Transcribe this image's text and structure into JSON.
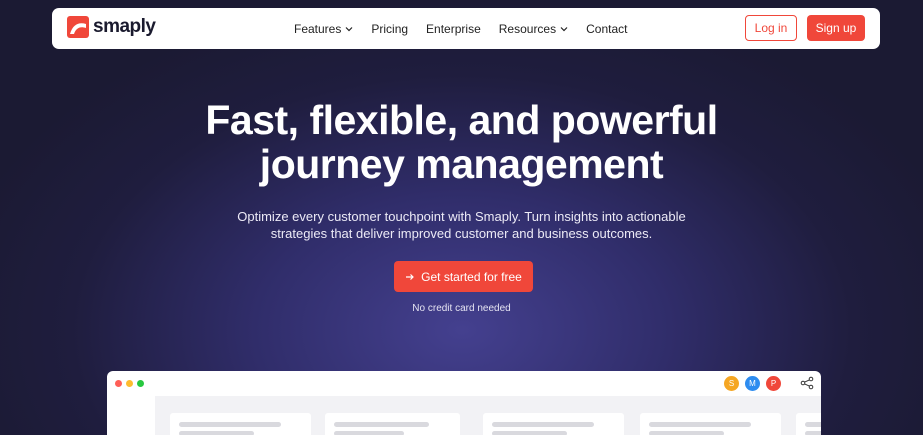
{
  "navbar": {
    "brand": "smaply",
    "links": [
      {
        "label": "Features",
        "has_dropdown": true
      },
      {
        "label": "Pricing",
        "has_dropdown": false
      },
      {
        "label": "Enterprise",
        "has_dropdown": false
      },
      {
        "label": "Resources",
        "has_dropdown": true
      },
      {
        "label": "Contact",
        "has_dropdown": false
      }
    ],
    "login_label": "Log in",
    "signup_label": "Sign up"
  },
  "hero": {
    "title_line1": "Fast, flexible, and powerful",
    "title_line2": "journey management",
    "subtitle_line1": "Optimize every customer touchpoint with Smaply. Turn insights into actionable",
    "subtitle_line2": "strategies that deliver improved customer and business outcomes.",
    "cta_label": "Get started for free",
    "cta_note": "No credit card needed"
  },
  "app_preview": {
    "avatars": [
      {
        "initial": "S",
        "color": "#f5a623"
      },
      {
        "initial": "M",
        "color": "#2d8cf0"
      },
      {
        "initial": "P",
        "color": "#f0473a"
      }
    ],
    "window_dots": [
      "#ff5f57",
      "#febc2e",
      "#28c840"
    ]
  },
  "colors": {
    "accent": "#f0473a",
    "background": "#1f1d3e",
    "brand_text": "#1a1a2e"
  },
  "icons": {
    "logo": "smaply-logo-icon",
    "dropdown": "chevron-down-icon",
    "cta": "arrow-right-icon",
    "share": "share-icon"
  }
}
